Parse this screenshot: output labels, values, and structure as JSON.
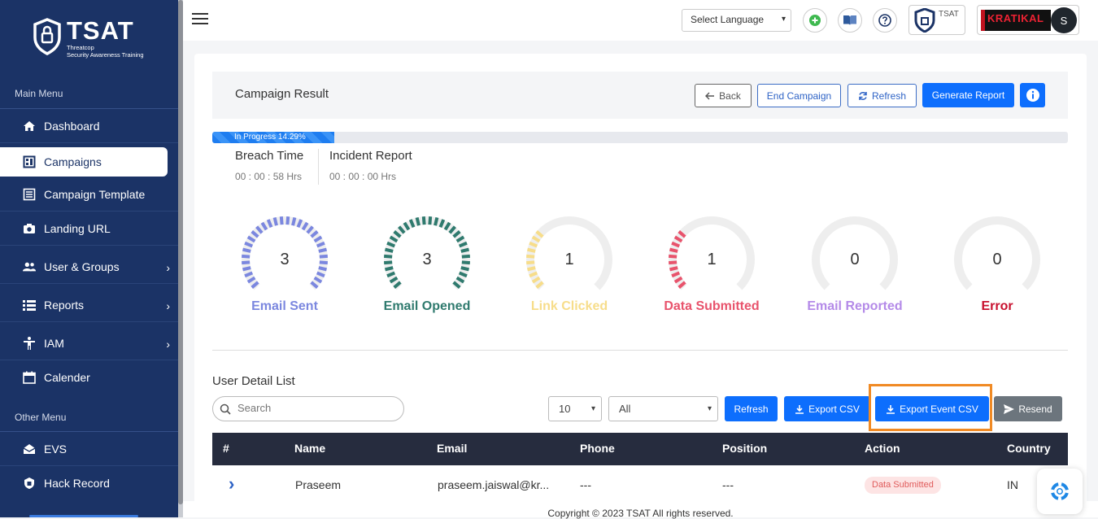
{
  "brand": {
    "title": "TSAT",
    "subtitle1": "Threatcop",
    "subtitle2": "Security Awareness Training"
  },
  "sidebar": {
    "main_menu": "Main Menu",
    "other_menu": "Other Menu",
    "items": [
      {
        "label": "Dashboard",
        "icon": "home-icon"
      },
      {
        "label": "Campaigns",
        "icon": "campaigns-icon",
        "active": true
      },
      {
        "label": "Campaign Template",
        "icon": "template-icon"
      },
      {
        "label": "Landing URL",
        "icon": "camera-icon"
      },
      {
        "label": "User & Groups",
        "icon": "users-icon",
        "chevron": "›"
      },
      {
        "label": "Reports",
        "icon": "list-icon",
        "chevron": "›"
      },
      {
        "label": "IAM",
        "icon": "person-icon",
        "chevron": "›"
      },
      {
        "label": "Calender",
        "icon": "calendar-icon"
      }
    ],
    "other_items": [
      {
        "label": "EVS",
        "icon": "mail-open-icon"
      },
      {
        "label": "Hack Record",
        "icon": "hack-icon"
      }
    ]
  },
  "topbar": {
    "language_label": "Select Language",
    "language_caret": "▾",
    "tsat_badge": "TSAT",
    "kratikal_text": "KRATIKAL",
    "avatar_letter": "S"
  },
  "campaign": {
    "title": "Campaign Result",
    "buttons": {
      "back": "Back",
      "end": "End Campaign",
      "refresh": "Refresh",
      "generate": "Generate Report"
    },
    "progress_label": "In Progress 14.29%",
    "progress": 0.1429,
    "breach_time_label": "Breach Time",
    "breach_time_value": "00 : 00 : 58 Hrs",
    "incident_label": "Incident Report",
    "incident_value": "00 : 00 : 00 Hrs"
  },
  "gauges": [
    {
      "label": "Email Sent",
      "value": "3",
      "fraction": 1.0,
      "color": "#7b87df"
    },
    {
      "label": "Email Opened",
      "value": "3",
      "fraction": 1.0,
      "color": "#2f7a6e"
    },
    {
      "label": "Link Clicked",
      "value": "1",
      "fraction": 0.3333,
      "color": "#f7dd8a"
    },
    {
      "label": "Data Submitted",
      "value": "1",
      "fraction": 0.3333,
      "color": "#e8536c"
    },
    {
      "label": "Email Reported",
      "value": "0",
      "fraction": 0,
      "color": "#b48ae8"
    },
    {
      "label": "Error",
      "value": "0",
      "fraction": 0,
      "color": "#c8102e"
    }
  ],
  "user_list": {
    "title": "User Detail List",
    "search_placeholder": "Search",
    "page_size": "10",
    "filter": "All",
    "dropdown_caret": "▾",
    "buttons": {
      "refresh": "Refresh",
      "export_csv": "Export CSV",
      "export_event_csv": "Export Event CSV",
      "resend": "Resend"
    },
    "columns": [
      "#",
      "Name",
      "Email",
      "Phone",
      "Position",
      "Action",
      "Country"
    ],
    "rows": [
      {
        "expand": "›",
        "name": "Praseem",
        "email": "praseem.jaiswal@kr...",
        "phone": "---",
        "position": "---",
        "action": "Data Submitted",
        "country": "IN"
      }
    ]
  },
  "footer": "Copyright © 2023 TSAT All rights reserved.",
  "colors": {
    "sidebar": "#1b3366",
    "primary": "#0d6efd",
    "table_head": "#262c3e",
    "highlight": "#f08a24"
  }
}
